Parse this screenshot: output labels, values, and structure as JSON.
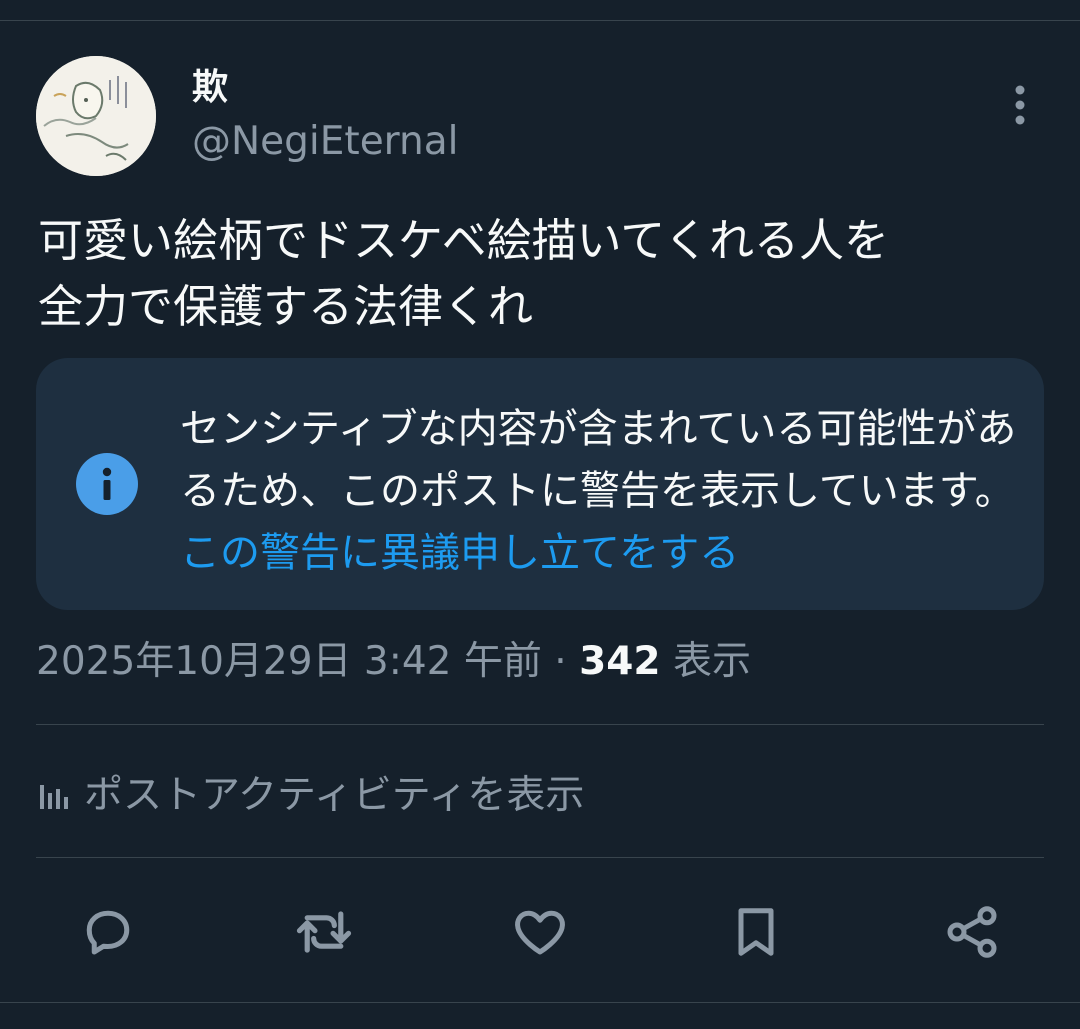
{
  "author": {
    "display_name": "欺",
    "handle": "@NegiEternal"
  },
  "tweet": {
    "text": "可愛い絵柄でドスケベ絵描いてくれる人を\n全力で保護する法律くれ"
  },
  "sensitive_warning": {
    "message": "センシティブな内容が含まれている可能性があるため、このポストに警告を表示しています。",
    "appeal_link": "この警告に異議申し立てをする"
  },
  "meta": {
    "timestamp": "2025年10月29日 3:42 午前",
    "separator": "·",
    "views_count": "342",
    "views_label": "表示"
  },
  "activity": {
    "label": "ポストアクティビティを表示"
  },
  "actions": [
    {
      "icon": "reply-icon"
    },
    {
      "icon": "retweet-icon"
    },
    {
      "icon": "like-icon"
    },
    {
      "icon": "bookmark-icon"
    },
    {
      "icon": "share-icon"
    }
  ],
  "colors": {
    "background": "#15202b",
    "card": "#1e2f40",
    "accent": "#1d9bf0",
    "secondary_text": "#8b98a5",
    "info_icon": "#4a9ee8",
    "divider": "#38444d"
  }
}
